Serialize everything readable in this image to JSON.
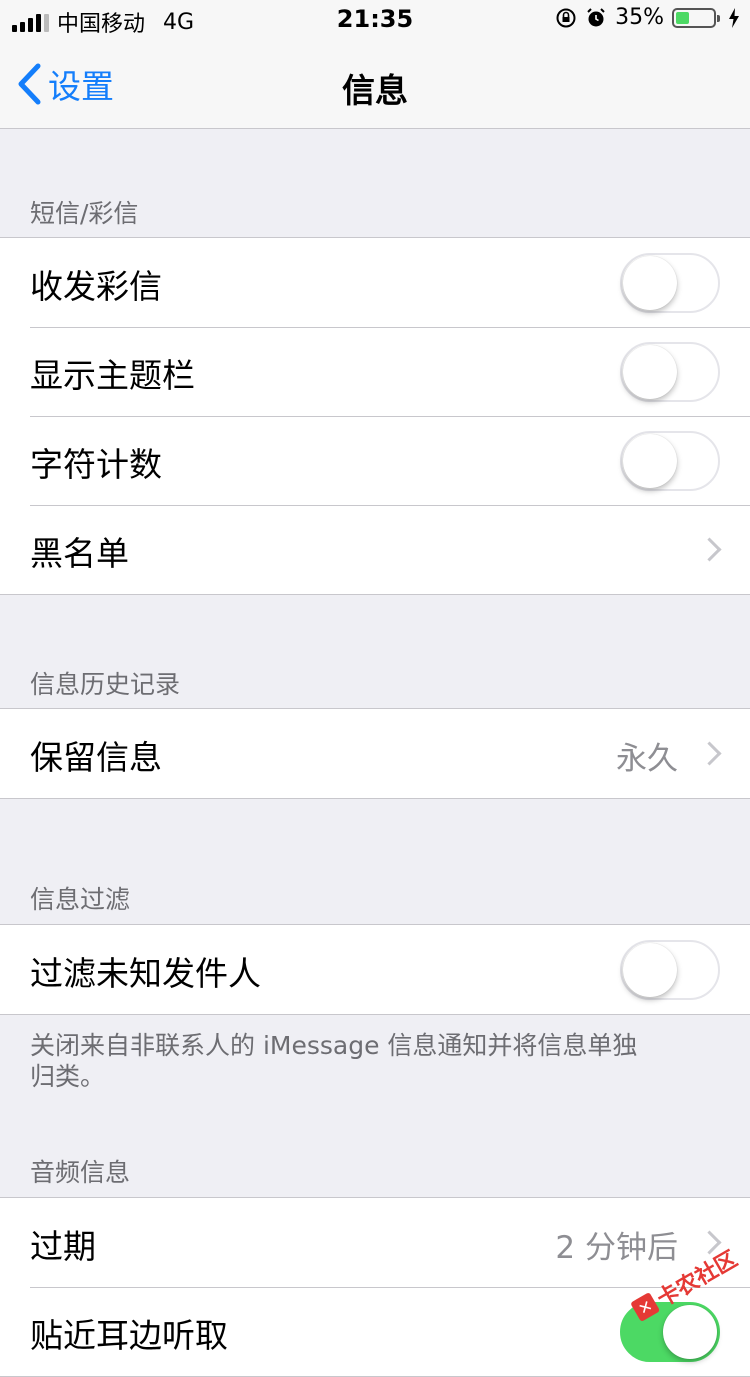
{
  "status_bar": {
    "carrier": "中国移动",
    "network": "4G",
    "time": "21:35",
    "battery_percent": "35%",
    "battery_level": 0.35,
    "icons": [
      "signal-icon",
      "rotation-lock-icon",
      "alarm-icon",
      "battery-icon",
      "charging-icon"
    ]
  },
  "nav": {
    "back_label": "设置",
    "title": "信息"
  },
  "sms_section": {
    "header": "短信/彩信",
    "rows": [
      {
        "label": "收发彩信",
        "type": "toggle",
        "on": false
      },
      {
        "label": "显示主题栏",
        "type": "toggle",
        "on": false
      },
      {
        "label": "字符计数",
        "type": "toggle",
        "on": false
      },
      {
        "label": "黑名单",
        "type": "link"
      }
    ]
  },
  "history_section": {
    "header": "信息历史记录",
    "rows": [
      {
        "label": "保留信息",
        "value": "永久",
        "type": "link"
      }
    ]
  },
  "filter_section": {
    "header": "信息过滤",
    "rows": [
      {
        "label": "过滤未知发件人",
        "type": "toggle",
        "on": false
      }
    ],
    "footer": "关闭来自非联系人的 iMessage 信息通知并将信息单独归类。"
  },
  "audio_section": {
    "header": "音频信息",
    "rows": [
      {
        "label": "过期",
        "value": "2 分钟后",
        "type": "link"
      },
      {
        "label": "贴近耳边听取",
        "type": "toggle",
        "on": true
      }
    ]
  },
  "watermark": {
    "text": "卡农社区"
  },
  "colors": {
    "accent": "#147efb",
    "toggle_on": "#4cd964",
    "background": "#efeff4",
    "secondary_text": "#6d6d72"
  }
}
